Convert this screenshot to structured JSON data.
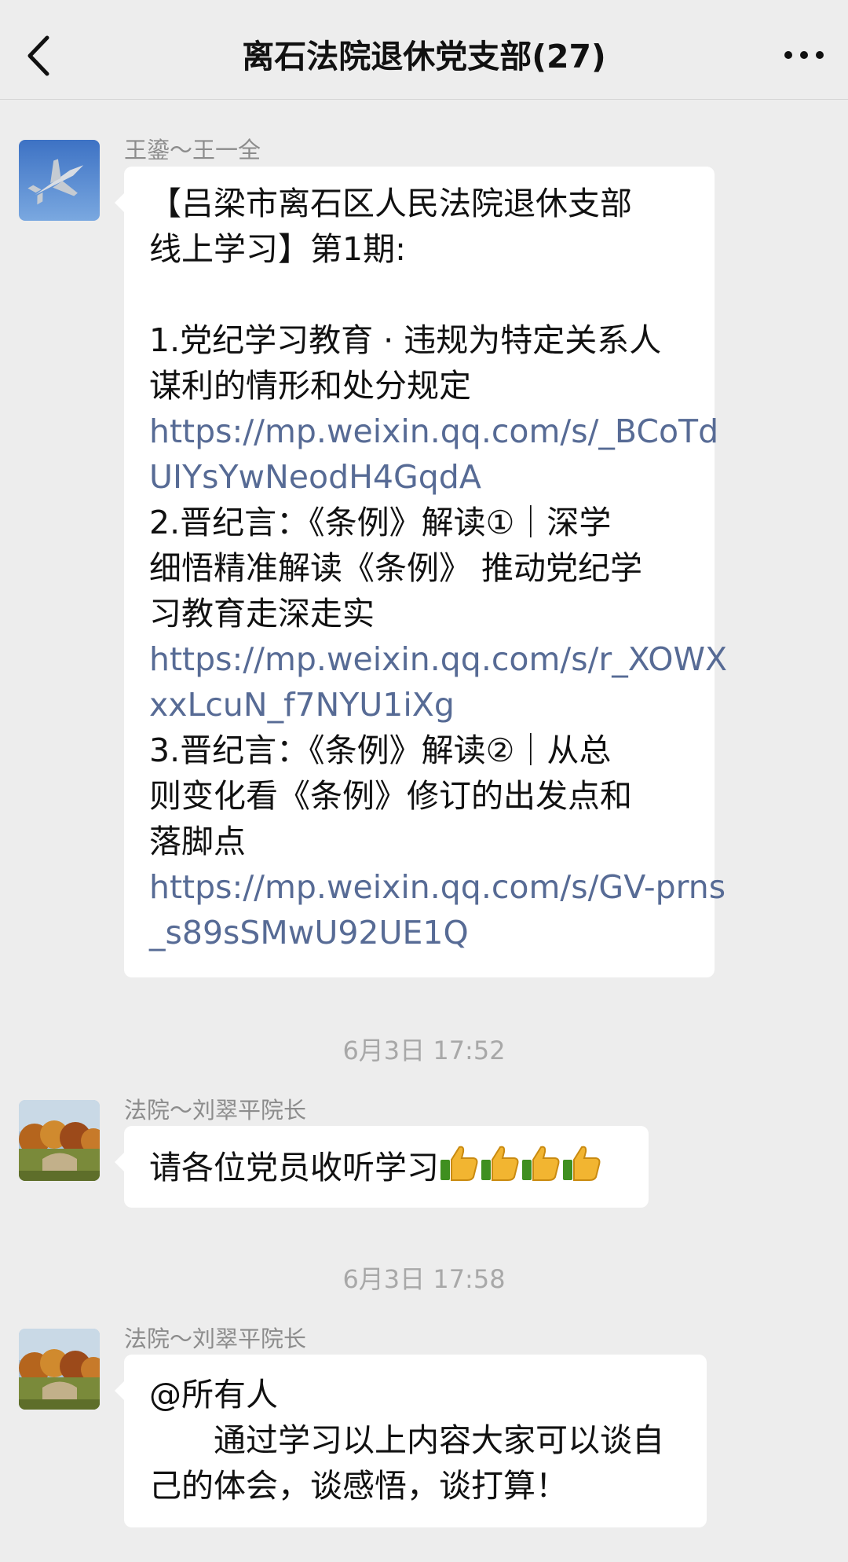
{
  "nav": {
    "title": "离石法院退休党支部(27)"
  },
  "messages": [
    {
      "sender": "王鎏～王一全",
      "lines": [
        "【吕梁市离石区人民法院退休支部",
        "线上学习】第1期:",
        "",
        "1.党纪学习教育 · 违规为特定关系人",
        "谋利的情形和处分规定",
        "https://mp.weixin.qq.com/s/_BCoTd",
        "UIYsYwNeodH4GqdA",
        "2.晋纪言：《条例》解读①｜深学",
        "细悟精准解读《条例》 推动党纪学",
        "习教育走深走实",
        "https://mp.weixin.qq.com/s/r_XOWX",
        "xxLcuN_f7NYU1iXg",
        "3.晋纪言：《条例》解读②｜从总",
        "则变化看《条例》修订的出发点和",
        "落脚点",
        "https://mp.weixin.qq.com/s/GV-prns",
        "_s89sSMwU92UE1Q"
      ]
    },
    {
      "time": "6月3日 17:52",
      "sender": "法院～刘翠平院长",
      "text": "请各位党员收听学习"
    },
    {
      "time": "6月3日 17:58",
      "sender": "法院～刘翠平院长",
      "lines": [
        "@所有人",
        "　　通过学习以上内容大家可以谈自",
        "己的体会，谈感悟，谈打算！"
      ]
    }
  ],
  "icons": {
    "back": "chevron-left-icon",
    "more": "more-dots-icon",
    "thumbs": "thumbs-up-emoji"
  }
}
